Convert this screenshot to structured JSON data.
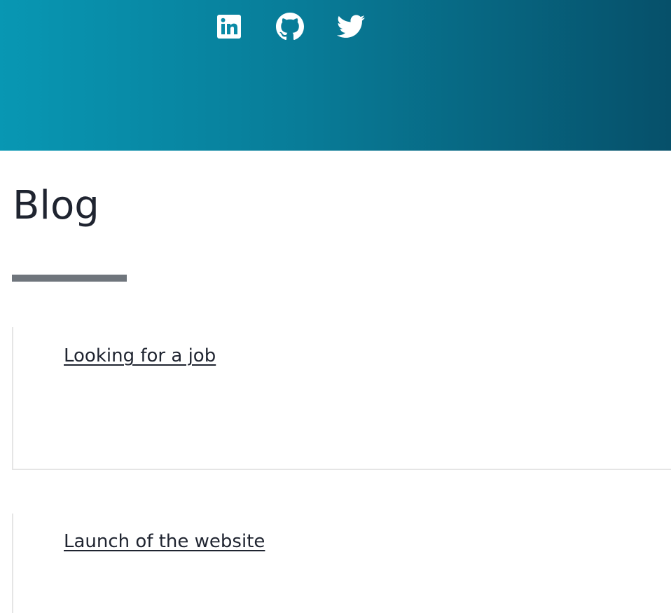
{
  "header": {
    "social_icons": [
      "linkedin-icon",
      "github-icon",
      "twitter-icon"
    ],
    "gradient_colors": [
      "#0897b3",
      "#087c98",
      "#06506a"
    ]
  },
  "page": {
    "title": "Blog",
    "underline_color": "#6f757c"
  },
  "posts": [
    {
      "title": "Looking for a job"
    },
    {
      "title": "Launch of the website"
    }
  ]
}
